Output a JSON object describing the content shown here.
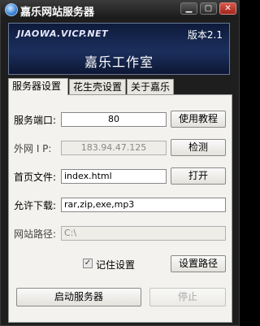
{
  "window": {
    "title": "嘉乐网站服务器",
    "controls": {
      "minimize": "▁",
      "maximize": "▢",
      "close": "✕"
    }
  },
  "banner": {
    "domain": "JIAOWA.VICP.NET",
    "version": "版本2.1",
    "studio": "嘉乐工作室"
  },
  "tabs": [
    {
      "label": "服务器设置",
      "active": true
    },
    {
      "label": "花生壳设置",
      "active": false
    },
    {
      "label": "关于嘉乐",
      "active": false
    }
  ],
  "server": {
    "port_label": "服务端口:",
    "port_value": "80",
    "tutorial_button": "使用教程",
    "ip_label": "外网 I P:",
    "ip_value": "183.94.47.125",
    "detect_button": "检测",
    "homepage_label": "首页文件:",
    "homepage_value": "index.html",
    "open_button": "打开",
    "download_label": "允许下载:",
    "download_value": "rar,zip,exe,mp3",
    "path_label": "网站路径:",
    "path_value": "C:\\",
    "remember_label": "记住设置",
    "remember_checked": true,
    "set_path_button": "设置路径",
    "start_button": "启动服务器",
    "stop_button": "停止"
  }
}
